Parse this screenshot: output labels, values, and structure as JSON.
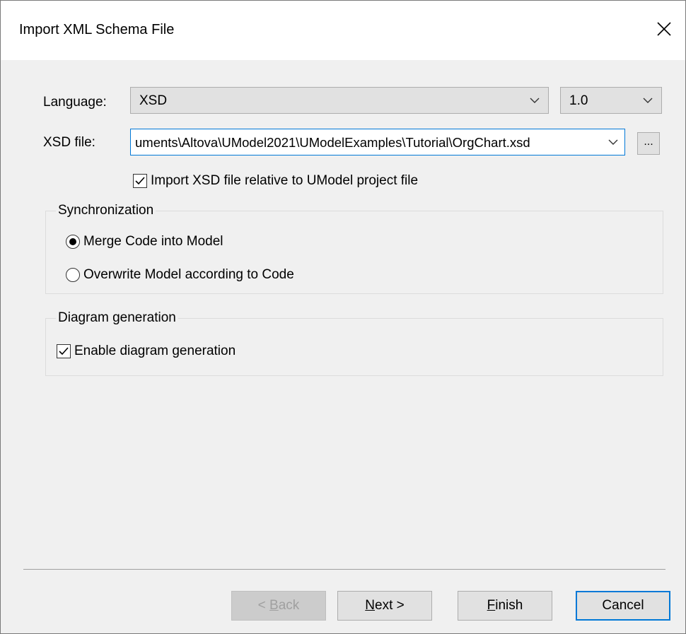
{
  "dialog": {
    "title": "Import XML Schema File",
    "close_glyph": "✕"
  },
  "language": {
    "label": "Language:",
    "value": "XSD",
    "version_value": "1.0"
  },
  "xsd_file": {
    "label": "XSD file:",
    "value": "uments\\Altova\\UModel2021\\UModelExamples\\Tutorial\\OrgChart.xsd",
    "browse_label": "..."
  },
  "relative_import": {
    "label": "Import XSD file relative to UModel project file",
    "checked": true
  },
  "synchronization": {
    "title": "Synchronization",
    "options": [
      {
        "label": "Merge Code into Model",
        "selected": true
      },
      {
        "label": "Overwrite Model according to Code",
        "selected": false
      }
    ]
  },
  "diagram_generation": {
    "title": "Diagram generation",
    "enable_label": "Enable diagram generation",
    "checked": true
  },
  "buttons": {
    "back_prefix": "< ",
    "back_mnemonic": "B",
    "back_rest": "ack",
    "next_mnemonic": "N",
    "next_rest": "ext >",
    "finish_mnemonic": "F",
    "finish_rest": "inish",
    "cancel": "Cancel"
  },
  "colors": {
    "accent": "#0078d7",
    "dialog_bg": "#f0f0f0",
    "button_bg": "#e1e1e1"
  }
}
